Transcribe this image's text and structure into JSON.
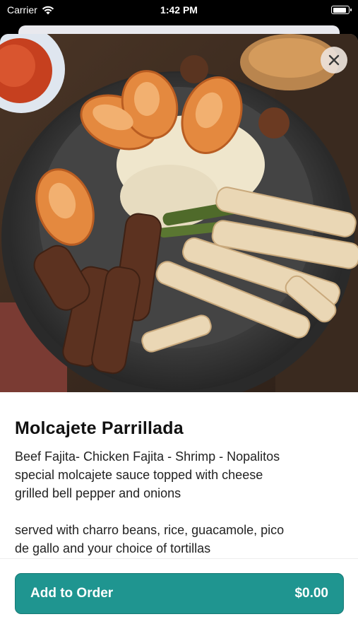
{
  "status_bar": {
    "carrier": "Carrier",
    "time": "1:42 PM"
  },
  "item": {
    "title": "Molcajete Parrillada",
    "description_lines": [
      "Beef Fajita- Chicken Fajita - Shrimp - Nopalitos",
      "special molcajete sauce topped with cheese",
      "grilled bell pepper and onions"
    ],
    "serving_lines": [
      "served with charro beans, rice, guacamole, pico",
      "de gallo and your choice of tortillas"
    ]
  },
  "footer": {
    "add_label": "Add to Order",
    "price": "$0.00"
  },
  "colors": {
    "accent": "#1f9590",
    "close_bg": "#ebe2da"
  },
  "icons": {
    "close": "close-icon",
    "wifi": "wifi-icon",
    "battery": "battery-icon"
  }
}
